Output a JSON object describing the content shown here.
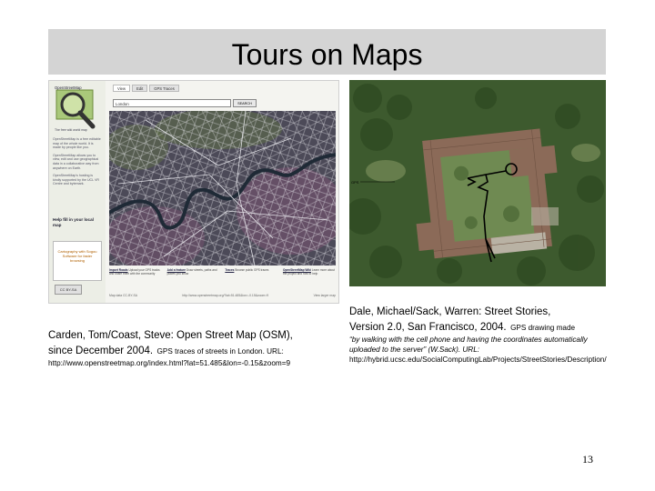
{
  "slide": {
    "title": "Tours on Maps",
    "page_number": "13"
  },
  "osm_screenshot": {
    "logo_label": "OpenStreetMap",
    "logo_subtitle": "The free wiki world map",
    "tabs": [
      "View",
      "Edit",
      "GPS Traces"
    ],
    "search_value": "London",
    "search_button": "SEARCH",
    "sidebar_paragraphs": [
      "OpenStreetMap is a free editable map of the whole world. It is made by people like you.",
      "OpenStreetMap allows you to view, edit and use geographical data in a collaborative way from anywhere on Earth.",
      "OpenStreetMap's hosting is kindly supported by the UCL VR Centre and bytemark."
    ],
    "news_title": "Help fill in your local map",
    "ad_text": "Cartography with Sogou Software for faster browsing",
    "cc_label": "CC BY-SA",
    "map_links": [
      {
        "title": "Import Roads",
        "text": "Upload your GPS tracks and share them with the community"
      },
      {
        "title": "Add a feature",
        "text": "Draw streets, paths and places you know"
      },
      {
        "title": "Traces",
        "text": "Browse public GPS traces"
      },
      {
        "title": "OpenStreetMap Wiki",
        "text": "Learn more about the project and how to help"
      }
    ],
    "footer_left": "Map data CC-BY-SA",
    "footer_mid": "http://www.openstreetmap.org/?lat=51.485&lon=-0.15&zoom=9",
    "footer_right": "View larger map",
    "colors": {
      "land": "#4c4a58",
      "heath": "#6a5068",
      "green": "#5f7048",
      "river": "#1f2a36",
      "roads": "#e9e9ee"
    }
  },
  "left_caption": {
    "authors": "Carden, Tom/Coast, Steve: Open Street Map (OSM),",
    "since": "since December 2004.",
    "detail": "GPS traces of streets in London. URL:",
    "url": "http://www.openstreetmap.org/index.html?lat=51.485&lon=-0.15&zoom=9"
  },
  "right_caption": {
    "authors": "Dale, Michael/Sack, Warren: Street Stories,",
    "version": "Version 2.0, San Francisco, 2004.",
    "detail": "GPS drawing made",
    "quote": "“by walking with the cell phone and having the coordinates automatically uploaded to the server” (W.Sack). URL:",
    "url": "http://hybrid.ucsc.edu/SocialComputingLab/Projects/StreetStories/Description/"
  },
  "satellite": {
    "colors": {
      "trees": "#3d5a2e",
      "roof": "#8b6a58",
      "courtyard": "#6f8a52",
      "pavement": "#b9b2a4",
      "path": "#000000"
    }
  }
}
